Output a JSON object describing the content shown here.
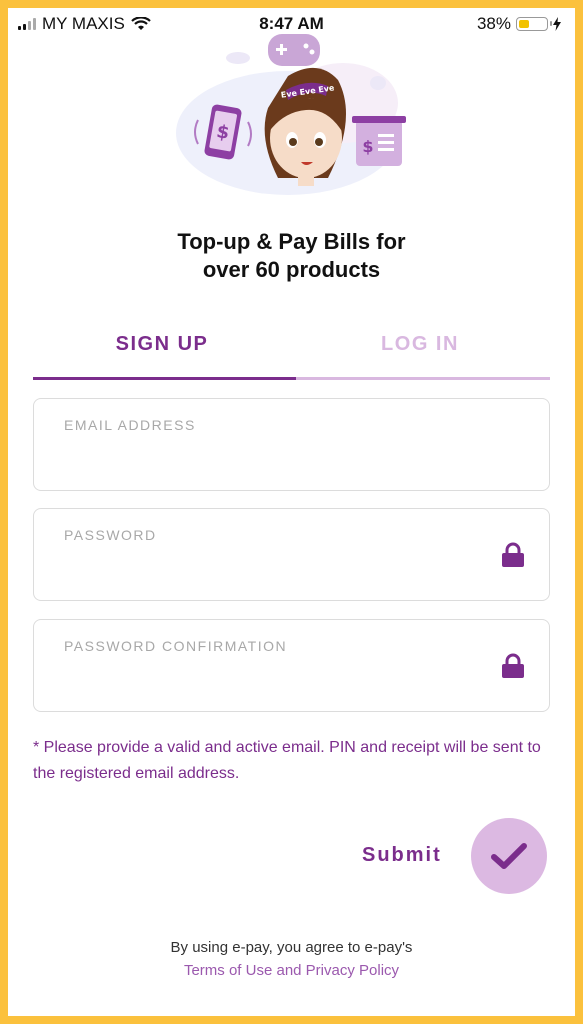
{
  "status_bar": {
    "carrier": "MY MAXIS",
    "time": "8:47 AM",
    "battery": "38%"
  },
  "hero": {
    "ribbon_text": "Eve Eve Eve"
  },
  "headline": {
    "line1": "Top-up & Pay Bills for",
    "line2": "over 60 products"
  },
  "tabs": [
    {
      "label": "SIGN UP",
      "active": true
    },
    {
      "label": "LOG IN",
      "active": false
    }
  ],
  "form": {
    "email_label": "EMAIL ADDRESS",
    "email_value": "",
    "password_label": "PASSWORD",
    "password_value": "",
    "password_confirm_label": "PASSWORD CONFIRMATION",
    "password_confirm_value": ""
  },
  "note": "* Please provide a valid and active email. PIN and receipt will be sent to the registered email address.",
  "submit_label": "Submit",
  "legal": {
    "line1": "By using e-pay, you agree to e-pay's",
    "links": "Terms of Use and Privacy Policy"
  },
  "colors": {
    "brand_purple": "#7b2d8c",
    "tab_inactive": "#d9b8e0",
    "submit_circle": "#dcb9e2",
    "frame": "#fbc13d"
  }
}
